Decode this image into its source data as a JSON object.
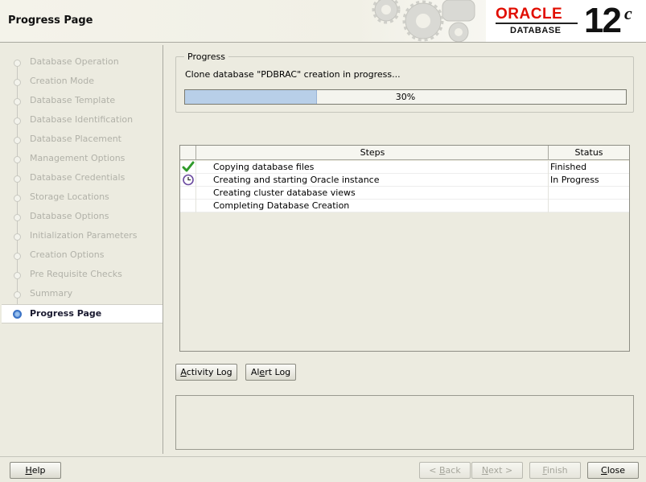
{
  "header": {
    "title": "Progress Page",
    "logo": {
      "brand": "ORACLE",
      "product": "DATABASE",
      "version": "12",
      "version_suffix": "c",
      "brand_color": "#e10d00"
    }
  },
  "sidebar": {
    "items": [
      {
        "label": "Database Operation"
      },
      {
        "label": "Creation Mode"
      },
      {
        "label": "Database Template"
      },
      {
        "label": "Database Identification"
      },
      {
        "label": "Database Placement"
      },
      {
        "label": "Management Options"
      },
      {
        "label": "Database Credentials"
      },
      {
        "label": "Storage Locations"
      },
      {
        "label": "Database Options"
      },
      {
        "label": "Initialization Parameters"
      },
      {
        "label": "Creation Options"
      },
      {
        "label": "Pre Requisite Checks"
      },
      {
        "label": "Summary"
      },
      {
        "label": "Progress Page"
      }
    ],
    "current_index": 13
  },
  "progress": {
    "group_label": "Progress",
    "message": "Clone database \"PDBRAC\" creation in progress...",
    "percent_text": "30%",
    "fraction": 0.3
  },
  "steps_table": {
    "headers": {
      "steps": "Steps",
      "status": "Status"
    },
    "rows": [
      {
        "icon": "check-icon",
        "step": "Copying database files",
        "status": "Finished"
      },
      {
        "icon": "clock-icon",
        "step": "Creating and starting Oracle instance",
        "status": "In Progress"
      },
      {
        "icon": "",
        "step": "Creating cluster database views",
        "status": ""
      },
      {
        "icon": "",
        "step": "Completing Database Creation",
        "status": ""
      }
    ]
  },
  "buttons": {
    "activity_log": {
      "pre": "",
      "u": "A",
      "post": "ctivity Log"
    },
    "alert_log": {
      "pre": "Al",
      "u": "e",
      "post": "rt Log"
    },
    "help": {
      "pre": "",
      "u": "H",
      "post": "elp"
    },
    "back": {
      "pre": "< ",
      "u": "B",
      "post": "ack"
    },
    "next": {
      "pre": "",
      "u": "N",
      "post": "ext >"
    },
    "finish": {
      "pre": "",
      "u": "F",
      "post": "inish"
    },
    "close": {
      "pre": "",
      "u": "C",
      "post": "lose"
    }
  },
  "colors": {
    "accent": "#3a72c5",
    "progress_fill": "#b8cfe8",
    "disabled_text": "#a6a69c"
  }
}
